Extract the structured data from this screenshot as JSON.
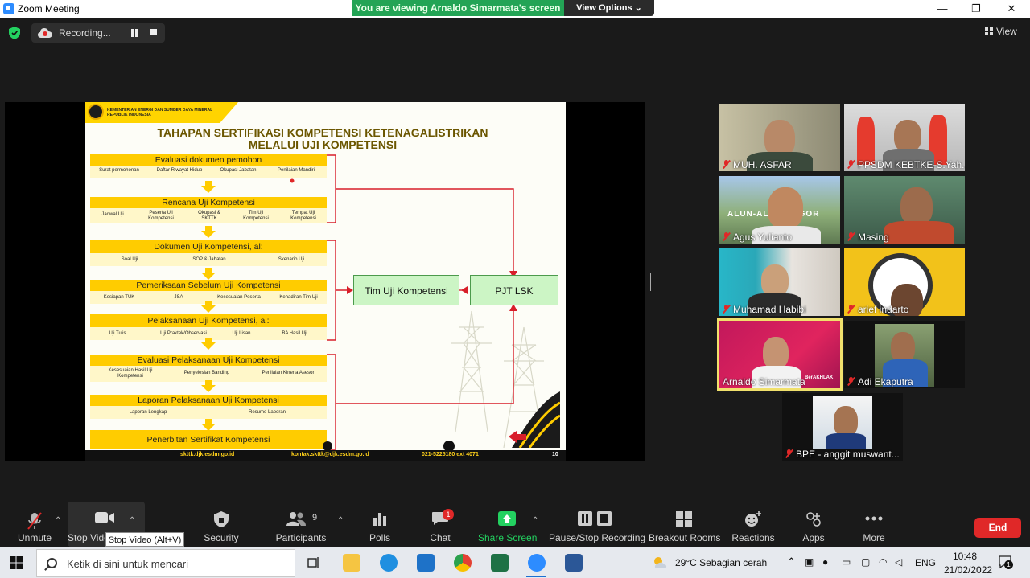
{
  "window": {
    "title": "Zoom Meeting",
    "controls": [
      "—",
      "❐",
      "✕"
    ]
  },
  "banner": {
    "viewing": "You are viewing Arnaldo Simarmata's screen",
    "view_options": "View Options"
  },
  "recording": {
    "label": "Recording..."
  },
  "view_button": "View",
  "slide": {
    "ministry": [
      "KEMENTERIAN ENERGI DAN SUMBER DAYA MINERAL",
      "REPUBLIK INDONESIA"
    ],
    "title_line1": "TAHAPAN SERTIFIKASI KOMPETENSI KETENAGALISTRIKAN",
    "title_line2": "MELALUI UJI KOMPETENSI",
    "steps": [
      {
        "title": "Evaluasi dokumen pemohon",
        "items": [
          "Surat permohonan",
          "Daftar Riwayat Hidup",
          "Okupasi Jabatan",
          "Penilaian Mandiri"
        ]
      },
      {
        "title": "Rencana Uji Kompetensi",
        "items": [
          "Jadwal Uji",
          "Peserta Uji Kompetensi",
          "Okupasi & SKTTK",
          "Tim Uji Kompetensi",
          "Tempat Uji Kompetensi"
        ]
      },
      {
        "title": "Dokumen Uji Kompetensi, al:",
        "items": [
          "Soal Uji",
          "SOP & Jabatan",
          "Skenario Uji"
        ]
      },
      {
        "title": "Pemeriksaan Sebelum Uji Kompetensi",
        "items": [
          "Kesiapan TUK",
          "JSA",
          "Kesesuaian Peserta",
          "Kehadiran Tim Uji"
        ]
      },
      {
        "title": "Pelaksanaan Uji Kompetensi, al:",
        "items": [
          "Uji Tulis",
          "Uji Praktek/Observasi",
          "Uji Lisan",
          "BA Hasil Uji"
        ]
      },
      {
        "title": "Evaluasi Pelaksanaan Uji Kompetensi",
        "items": [
          "Kesesuaian Hasil Uji Kompetensi",
          "Penyelesian Banding",
          "Penilaian Kinerja Asesor"
        ]
      },
      {
        "title": "Laporan Pelaksanaan Uji Kompetensi",
        "items": [
          "Laporan Lengkap",
          "Resume Laporan"
        ]
      },
      {
        "title": "Penerbitan Sertifikat Kompetensi",
        "items": []
      }
    ],
    "box_tim": "Tim Uji Kompetensi",
    "box_pjt": "PJT LSK",
    "footer": {
      "website": "skttk.djk.esdm.go.id",
      "email": "kontak.skttk@djk.esdm.go.id",
      "phone": "021-5225180 ext 4071",
      "page": "10"
    }
  },
  "participants": [
    {
      "name": "MUH. ASFAR",
      "muted": true
    },
    {
      "name": "PPSDM KEBTKE-S.Yah...",
      "muted": true
    },
    {
      "name": "Agus Yulianto",
      "muted": true
    },
    {
      "name": "Masing",
      "muted": true
    },
    {
      "name": "Muhamad Habibi",
      "muted": true
    },
    {
      "name": "arief indarto",
      "muted": true
    },
    {
      "name": "Arnaldo Simarmata",
      "muted": false
    },
    {
      "name": "Adi Ekaputra",
      "muted": true
    },
    {
      "name": "BPE - anggit muswant...",
      "muted": true
    }
  ],
  "tile_text": {
    "alun_alun": "ALUN-ALUN BOGOR",
    "arnaldo_logo": "BerAKHLAK"
  },
  "toolbar": {
    "unmute": "Unmute",
    "stop_video": "Stop Video",
    "stop_video_tooltip": "Stop Video (Alt+V)",
    "security": "Security",
    "participants": "Participants",
    "participants_count": "9",
    "polls": "Polls",
    "chat": "Chat",
    "chat_badge": "1",
    "share_screen": "Share Screen",
    "pause_stop_recording": "Pause/Stop Recording",
    "breakout_rooms": "Breakout Rooms",
    "reactions": "Reactions",
    "apps": "Apps",
    "more": "More",
    "end": "End"
  },
  "taskbar": {
    "search_placeholder": "Ketik di sini untuk mencari",
    "weather": "29°C  Sebagian cerah",
    "language": "ENG",
    "time": "10:48",
    "date": "21/02/2022",
    "notif_count": "1"
  },
  "colors": {
    "zoom_green": "#23a455",
    "accent_yellow": "#ffcc00",
    "end_red": "#e02828",
    "active_speaker_border": "#f0e06c"
  }
}
